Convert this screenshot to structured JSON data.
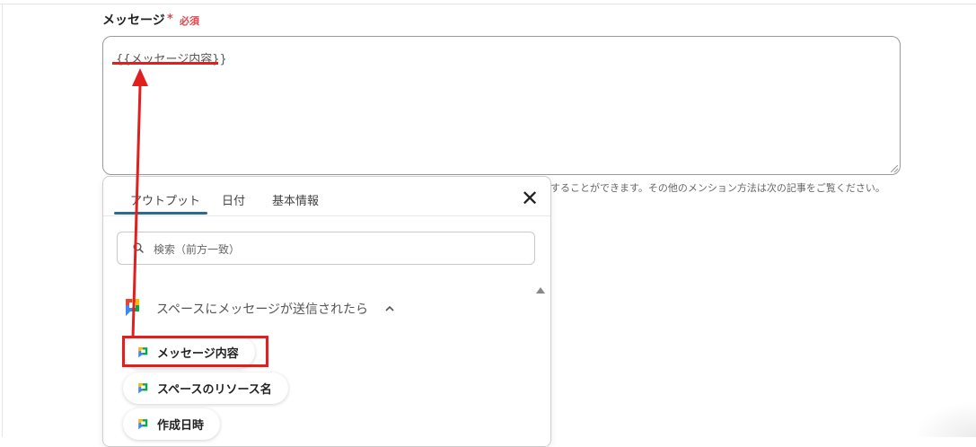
{
  "field": {
    "label": "メッセージ",
    "required_star": "*",
    "required_text": "必須",
    "value": "{{メッセージ内容}}"
  },
  "hint_text": "することができます。その他のメンション方法は次の記事をご覧ください。",
  "popup": {
    "tabs": [
      "アウトプット",
      "日付",
      "基本情報"
    ],
    "active_tab": "アウトプット",
    "close_symbol": "✕",
    "search": {
      "placeholder": "検索（前方一致）",
      "value": ""
    },
    "group": {
      "label": "スペースにメッセージが送信されたら",
      "expanded": true,
      "icon": "google-chat-icon"
    },
    "items": [
      {
        "label": "メッセージ内容",
        "icon": "google-chat-icon",
        "highlighted": true
      },
      {
        "label": "スペースのリソース名",
        "icon": "google-chat-icon",
        "highlighted": false
      },
      {
        "label": "作成日時",
        "icon": "google-chat-icon",
        "highlighted": false
      }
    ]
  },
  "colors": {
    "required": "#e0474c",
    "annotation": "#e21f1f",
    "tab_active": "#2f6b89",
    "chat_green": "#00ac47",
    "chat_blue": "#4285f4",
    "chat_yellow": "#ffba00",
    "chat_red": "#ea4335"
  }
}
